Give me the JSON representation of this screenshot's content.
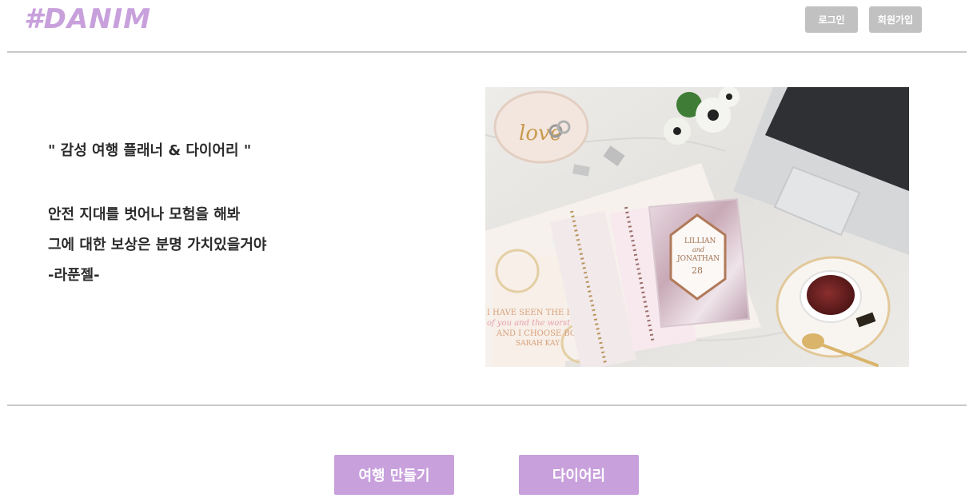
{
  "header": {
    "logo": "#DANIM",
    "login_label": "로그인",
    "signup_label": "회원가입"
  },
  "hero": {
    "title": "\" 감성 여행 플래너 & 다이어리 \"",
    "lines": [
      "안전 지대를 벗어나 모험을 해봐",
      "그에 대한 보상은 분명 가치있을거야",
      "-라푼젤-"
    ],
    "image_text": {
      "love": "love",
      "card_name1": "LILLIAN",
      "card_and": "and",
      "card_name2": "JONATHAN",
      "card_date": "28",
      "quote_line1": "I HAVE SEEN THE BEST",
      "quote_line2": "of you and the worst of you",
      "quote_line3": "AND I CHOOSE BOTH.",
      "quote_author": "SARAH KAY"
    }
  },
  "actions": {
    "make_trip_label": "여행 만들기",
    "diary_label": "다이어리"
  },
  "colors": {
    "brand": "#c8a0dc",
    "auth_button": "#c1c1c1",
    "divider": "#c9c9c9"
  }
}
